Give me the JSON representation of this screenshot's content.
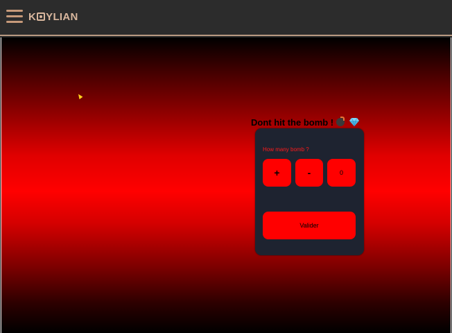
{
  "header": {
    "logo_prefix": "K",
    "logo_suffix": "YLIAN"
  },
  "game": {
    "title": "Dont hit the bomb !",
    "question": "How many bomb ?",
    "plus_label": "+",
    "minus_label": "-",
    "count": "0",
    "validate_label": "Valider"
  },
  "colors": {
    "accent": "#ff0000",
    "card_background": "#1e2330",
    "header_background": "#2c2c2c",
    "logo": "#d9b79e"
  },
  "icons": [
    "menu-icon",
    "bomb-icon",
    "diamond-icon",
    "cursor-icon"
  ]
}
